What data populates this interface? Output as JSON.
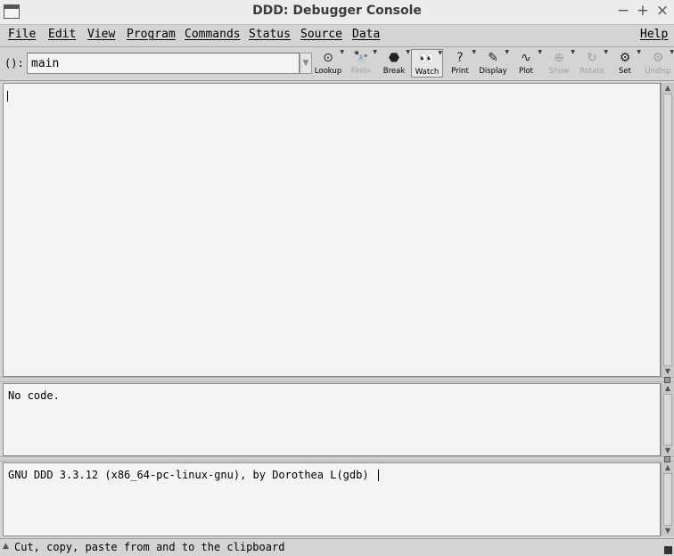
{
  "window": {
    "title": "DDD: Debugger Console"
  },
  "window_controls": {
    "minimize": "−",
    "maximize": "+",
    "close": "×"
  },
  "menu": [
    {
      "label": "File"
    },
    {
      "label": "Edit"
    },
    {
      "label": "View"
    },
    {
      "label": "Program"
    },
    {
      "label": "Commands"
    },
    {
      "label": "Status"
    },
    {
      "label": "Source"
    },
    {
      "label": "Data"
    },
    {
      "label": "Help"
    }
  ],
  "toolbar": {
    "arg_label": "():",
    "arg_value": "main",
    "buttons": [
      {
        "label": "Lookup",
        "icon": "lookup-icon",
        "glyph": "⊙",
        "enabled": true,
        "active": false
      },
      {
        "label": "Find»",
        "icon": "find-icon",
        "glyph": "🔭",
        "enabled": false,
        "active": false
      },
      {
        "label": "Break",
        "icon": "stop-sign-icon",
        "glyph": "⬣",
        "enabled": true,
        "active": false
      },
      {
        "label": "Watch",
        "icon": "watch-eyes-icon",
        "glyph": "👀",
        "enabled": true,
        "active": true
      },
      {
        "label": "Print",
        "icon": "print-icon",
        "glyph": "?",
        "enabled": true,
        "active": false
      },
      {
        "label": "Display",
        "icon": "display-icon",
        "glyph": "✎",
        "enabled": true,
        "active": false
      },
      {
        "label": "Plot",
        "icon": "plot-icon",
        "glyph": "∿",
        "enabled": true,
        "active": false
      },
      {
        "label": "Show",
        "icon": "show-icon",
        "glyph": "⊕",
        "enabled": false,
        "active": false
      },
      {
        "label": "Rotate",
        "icon": "rotate-icon",
        "glyph": "↻",
        "enabled": false,
        "active": false
      },
      {
        "label": "Set",
        "icon": "set-icon",
        "glyph": "⚙",
        "enabled": true,
        "active": false
      },
      {
        "label": "Undisp",
        "icon": "undisp-icon",
        "glyph": "⚙",
        "enabled": false,
        "active": false
      }
    ]
  },
  "source_pane": {
    "text": "No code."
  },
  "console": {
    "text": "GNU DDD 3.3.12 (x86_64-pc-linux-gnu), by Dorothea L(gdb) "
  },
  "status": {
    "text": "Cut, copy, paste from and to the clipboard"
  }
}
